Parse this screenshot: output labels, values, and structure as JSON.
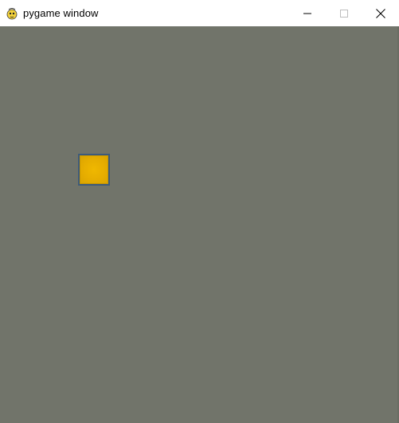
{
  "window": {
    "title": "pygame window",
    "app_icon": "pygame-snake-icon",
    "controls": {
      "minimize_icon": "minimize-icon",
      "maximize_icon": "maximize-icon",
      "close_icon": "close-icon"
    }
  },
  "game": {
    "background_color": "#71746a",
    "player": {
      "fill_color": "#e6ad00",
      "border_color": "#3d5a7a"
    }
  }
}
